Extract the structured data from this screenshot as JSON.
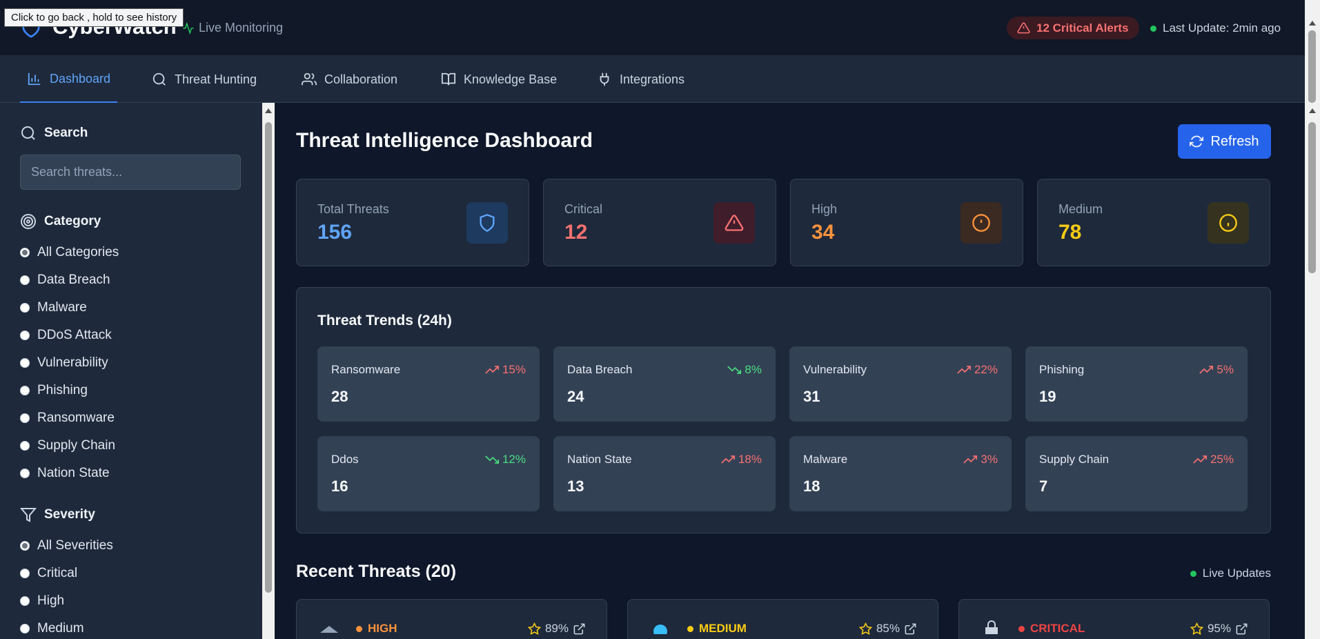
{
  "tooltip": "Click to go back , hold to see history",
  "header": {
    "brand": "CyberWatch",
    "live_label": "Live Monitoring",
    "alerts_label": "12 Critical Alerts",
    "last_update": "Last Update: 2min ago"
  },
  "nav": [
    {
      "label": "Dashboard",
      "icon": "bar-chart-icon",
      "active": true
    },
    {
      "label": "Threat Hunting",
      "icon": "search-icon"
    },
    {
      "label": "Collaboration",
      "icon": "users-icon"
    },
    {
      "label": "Knowledge Base",
      "icon": "book-icon"
    },
    {
      "label": "Integrations",
      "icon": "plug-icon"
    }
  ],
  "sidebar": {
    "search_heading": "Search",
    "search_placeholder": "Search threats...",
    "category_heading": "Category",
    "categories": [
      "All Categories",
      "Data Breach",
      "Malware",
      "DDoS Attack",
      "Vulnerability",
      "Phishing",
      "Ransomware",
      "Supply Chain",
      "Nation State"
    ],
    "category_selected": "All Categories",
    "severity_heading": "Severity",
    "severities": [
      "All Severities",
      "Critical",
      "High",
      "Medium"
    ],
    "severity_selected": "All Severities"
  },
  "main": {
    "title": "Threat Intelligence Dashboard",
    "refresh_label": "Refresh",
    "stats": [
      {
        "label": "Total Threats",
        "value": "156",
        "color": "#60a5fa",
        "icon": "shield-icon"
      },
      {
        "label": "Critical",
        "value": "12",
        "color": "#f87171",
        "icon": "alert-triangle-icon"
      },
      {
        "label": "High",
        "value": "34",
        "color": "#fb923c",
        "icon": "alert-circle-icon"
      },
      {
        "label": "Medium",
        "value": "78",
        "color": "#facc15",
        "icon": "info-icon"
      }
    ],
    "trends_title": "Threat Trends (24h)",
    "trends": [
      {
        "name": "Ransomware",
        "count": "28",
        "change": "15%",
        "direction": "up"
      },
      {
        "name": "Data Breach",
        "count": "24",
        "change": "8%",
        "direction": "down"
      },
      {
        "name": "Vulnerability",
        "count": "31",
        "change": "22%",
        "direction": "up"
      },
      {
        "name": "Phishing",
        "count": "19",
        "change": "5%",
        "direction": "up"
      },
      {
        "name": "Ddos",
        "count": "16",
        "change": "12%",
        "direction": "down"
      },
      {
        "name": "Nation State",
        "count": "13",
        "change": "18%",
        "direction": "up"
      },
      {
        "name": "Malware",
        "count": "18",
        "change": "3%",
        "direction": "up"
      },
      {
        "name": "Supply Chain",
        "count": "7",
        "change": "25%",
        "direction": "up"
      }
    ],
    "recent_title": "Recent Threats (20)",
    "live_updates": "Live Updates",
    "recent": [
      {
        "severity": "HIGH",
        "color": "#fb923c",
        "confidence": "89%"
      },
      {
        "severity": "MEDIUM",
        "color": "#facc15",
        "confidence": "85%"
      },
      {
        "severity": "CRITICAL",
        "color": "#ef4444",
        "confidence": "95%"
      }
    ]
  }
}
